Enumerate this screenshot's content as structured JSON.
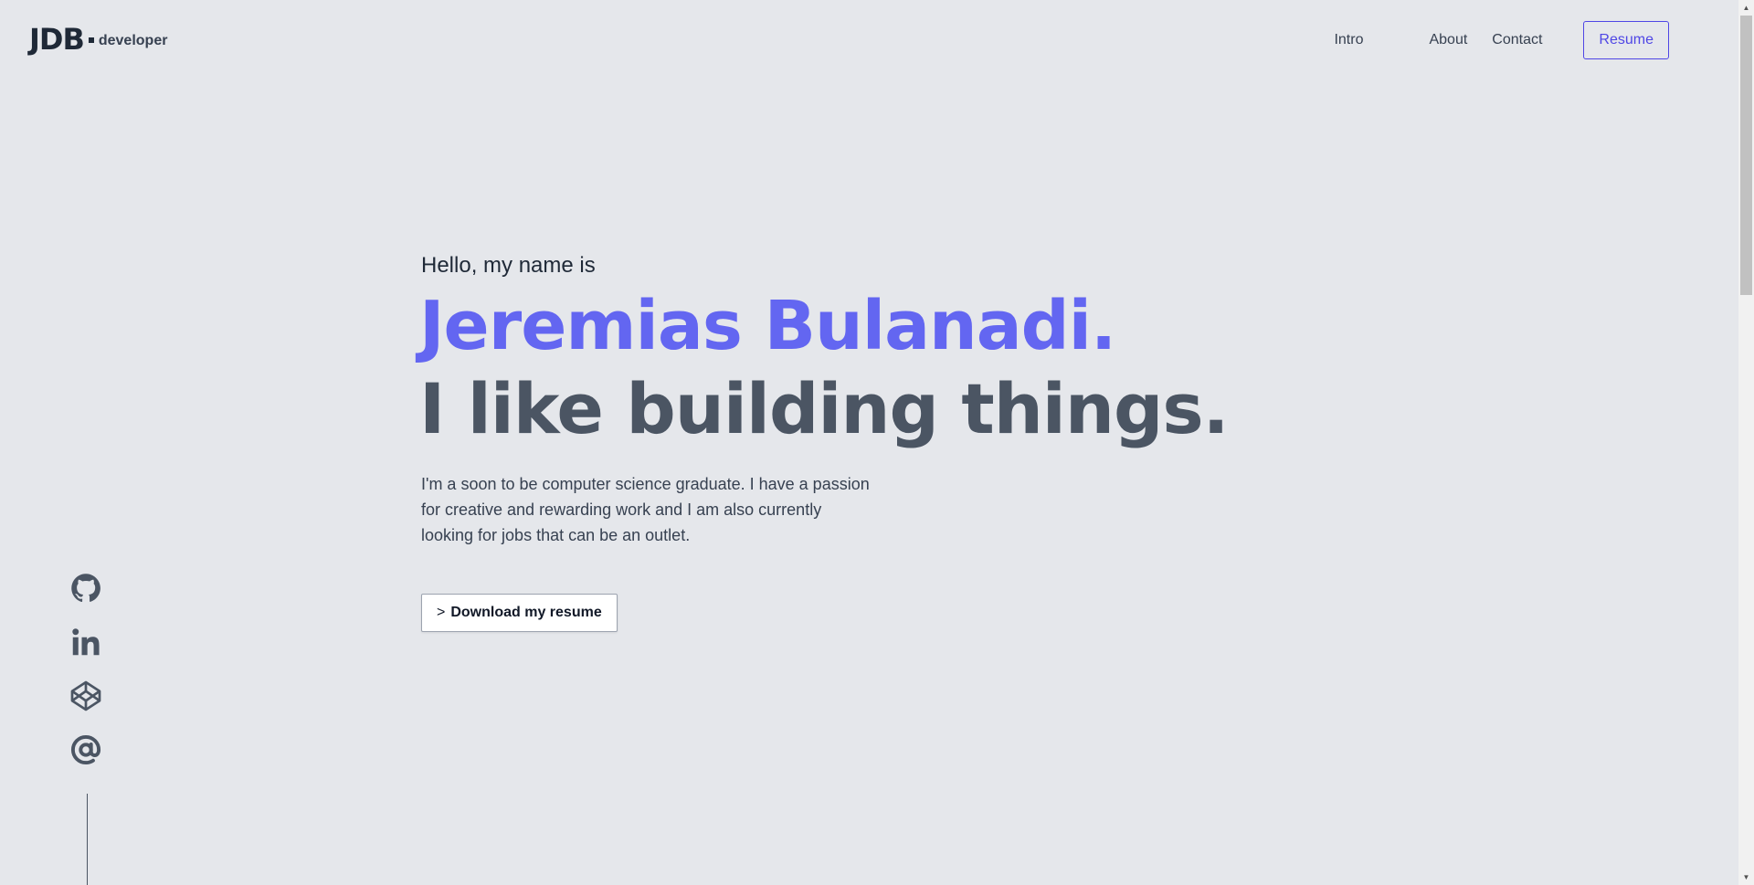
{
  "header": {
    "logo_mark": "JDB",
    "logo_sub": "developer",
    "nav": {
      "intro": "Intro",
      "about": "About",
      "contact": "Contact",
      "resume": "Resume"
    }
  },
  "hero": {
    "greeting": "Hello, my name is",
    "name": "Jeremias Bulanadi.",
    "tagline": "I like building things.",
    "bio": "I'm a soon to be computer science graduate. I have a passion for creative and rewarding work and I am also currently looking for jobs that can be an outlet.",
    "download_prompt": ">",
    "download_label": "Download my resume"
  },
  "social": {
    "icons": [
      "github-icon",
      "linkedin-icon",
      "codepen-icon",
      "at-icon"
    ]
  },
  "colors": {
    "background": "#e5e7eb",
    "accent": "#6366f1",
    "accent_dark": "#4f46e5",
    "text_dark": "#1f2937",
    "text_gray": "#4b5563"
  }
}
